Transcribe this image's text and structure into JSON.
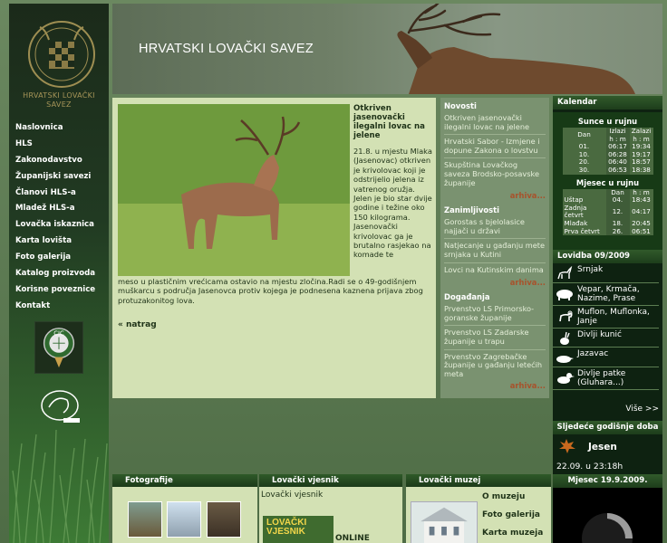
{
  "site": {
    "title": "HRVATSKI LOVAČKI SAVEZ",
    "logo_text": "HRVATSKI LOVAČKI SAVEZ"
  },
  "nav": [
    "Naslovnica",
    "HLS",
    "Zakonodavstvo",
    "Županijski savezi",
    "Članovi HLS-a",
    "Mladež HLS-a",
    "Lovačka iskaznica",
    "Karta lovišta",
    "Foto galerija",
    "Katalog proizvoda",
    "Korisne poveznice",
    "Kontakt"
  ],
  "badges": {
    "cic": "CIC"
  },
  "article": {
    "title": "Otkriven jasenovački ilegalni lovac na jelene",
    "body_side": "21.8. u mjestu Mlaka (Jasenovac) otkriven je krivolovac koji je odstrijelio jelena iz vatrenog oružja. Jelen je bio star dvije godine i težine oko 150 kilograma. Jasenovački krivolovac ga je brutalno rasjekao na komade te",
    "body_bottom": "meso u plastičnim vrećicama ostavio na mjestu zločina.Radi se o 49-godišnjem muškarcu s područja Jasenovca protiv kojega je podnesena kaznena prijava zbog protuzakonitog lova.",
    "back": "« natrag"
  },
  "news": {
    "sections": [
      {
        "title": "Novosti",
        "items": [
          "Otkriven jasenovački ilegalni lovac na jelene",
          "Hrvatski Sabor - Izmjene i dopune Zakona o lovstvu",
          "Skupština Lovačkog saveza Brodsko-posavske županije"
        ]
      },
      {
        "title": "Zanimljivosti",
        "items": [
          "Gorostas s bjelolasice najjači u državi",
          "Natjecanje u gađanju mete srnjaka u Kutini",
          "Lovci na Kutinskim danima"
        ]
      },
      {
        "title": "Događanja",
        "items": [
          "Prvenstvo LS Primorsko-goranske županije",
          "Prvenstvo LS Zadarske županije u trapu",
          "Prvenstvo Zagrebačke županije u gađanju letećih meta"
        ]
      }
    ],
    "more": "arhiva..."
  },
  "calendar": {
    "title": "Kalendar",
    "sun_title": "Sunce u rujnu",
    "sun_header": [
      "Dan",
      "Izlazi h : m",
      "Zalazi h : m"
    ],
    "sun_rows": [
      [
        "01.",
        "06:17",
        "19:34"
      ],
      [
        "10.",
        "06:28",
        "19:17"
      ],
      [
        "20.",
        "06:40",
        "18:57"
      ],
      [
        "30.",
        "06:53",
        "18:38"
      ]
    ],
    "moon_title": "Mjesec u rujnu",
    "moon_header": [
      "",
      "Dan",
      "h : m"
    ],
    "moon_rows": [
      [
        "Uštap",
        "04.",
        "18:43"
      ],
      [
        "Zadnja četvrt",
        "12.",
        "04:17"
      ],
      [
        "Mlađak",
        "18.",
        "20:45"
      ],
      [
        "Prva četvrt",
        "26.",
        "06:51"
      ]
    ]
  },
  "lovidba": {
    "title": "Lovidba 09/2009",
    "items": [
      {
        "icon": "deer-icon",
        "label": "Srnjak"
      },
      {
        "icon": "boar-icon",
        "label": "Vepar, Krmača, Nazime, Prase"
      },
      {
        "icon": "mouflon-icon",
        "label": "Muflon, Muflonka, Janje"
      },
      {
        "icon": "rabbit-icon",
        "label": "Divlji kunić"
      },
      {
        "icon": "badger-icon",
        "label": "Jazavac"
      },
      {
        "icon": "duck-icon",
        "label": "Divlje patke (Gluhara...)"
      }
    ],
    "more": "Više >>"
  },
  "season": {
    "title": "Sljedeće godišnje doba",
    "name": "Jesen",
    "date": "22.09. u 23:18h"
  },
  "moon": {
    "title": "Mjesec 19.9.2009."
  },
  "bottom": {
    "foto_title": "Fotografije",
    "vjesnik_title": "Lovački vjesnik",
    "vjesnik_text": "Lovački vjesnik",
    "vjesnik_cover": "LOVAČKI VJESNIK",
    "vjesnik_online": "ONLINE",
    "muzej_title": "Lovački muzej",
    "muzej_links": [
      "O muzeju",
      "Foto galerija",
      "Karta muzeja"
    ]
  },
  "colors": {
    "accent": "#1f3318",
    "panel": "#d3e1b4",
    "dark": "#0e2211",
    "link_more": "#a8522b"
  }
}
